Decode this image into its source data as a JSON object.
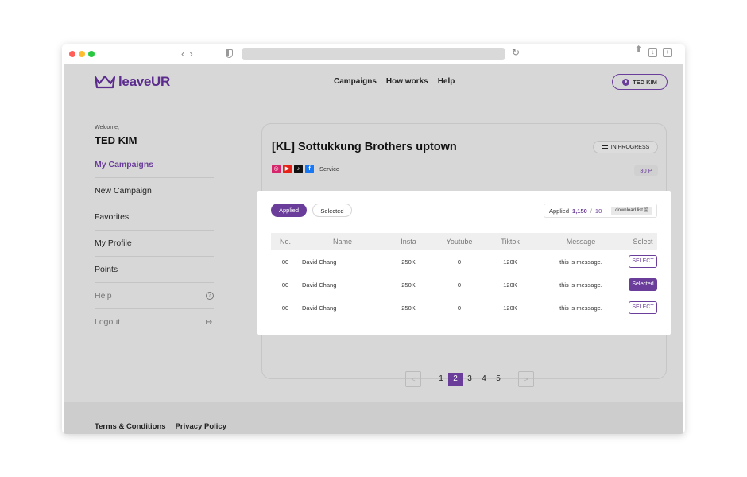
{
  "browser": {
    "icons": [
      "back-icon",
      "forward-icon",
      "shield-icon",
      "reload-icon",
      "share-icon",
      "download-icon",
      "new-tab-icon"
    ]
  },
  "header": {
    "logo_text": "leaveUR",
    "nav": [
      "Campaigns",
      "How works",
      "Help"
    ],
    "user_button": "TED KIM"
  },
  "sidebar": {
    "welcome": "Welcome,",
    "username": "TED KIM",
    "items": [
      {
        "label": "My Campaigns",
        "state": "active"
      },
      {
        "label": "New Campaign"
      },
      {
        "label": "Favorites"
      },
      {
        "label": "My Profile"
      },
      {
        "label": "Points"
      },
      {
        "label": "Help",
        "icon": "help-circle-icon"
      },
      {
        "label": "Logout",
        "icon": "logout-icon"
      }
    ]
  },
  "campaign": {
    "title": "[KL] Sottukkung Brothers uptown",
    "status": "IN PROGRESS",
    "platforms": [
      "instagram-icon",
      "youtube-icon",
      "tiktok-icon",
      "facebook-icon"
    ],
    "category": "Service",
    "points": "30 P"
  },
  "panel": {
    "tabs": [
      "Applied",
      "Selected"
    ],
    "active_tab": "Applied",
    "counter": {
      "label": "Applied",
      "applied": "1,150",
      "separator": "/",
      "total": "10",
      "download": "download list"
    },
    "columns": [
      "No.",
      "Name",
      "Insta",
      "Youtube",
      "Tiktok",
      "Message",
      "Select"
    ],
    "rows": [
      {
        "no": "00",
        "name": "David Chang",
        "insta": "250K",
        "youtube": "0",
        "tiktok": "120K",
        "message": "this is message.",
        "select": "SELECT"
      },
      {
        "no": "00",
        "name": "David Chang",
        "insta": "250K",
        "youtube": "0",
        "tiktok": "120K",
        "message": "this is message.",
        "select": "Selected"
      },
      {
        "no": "00",
        "name": "David Chang",
        "insta": "250K",
        "youtube": "0",
        "tiktok": "120K",
        "message": "this is message.",
        "select": "SELECT"
      }
    ]
  },
  "pagination": {
    "prev": "<",
    "next": ">",
    "pages": [
      "1",
      "2",
      "3",
      "4",
      "5"
    ],
    "current": "2"
  },
  "footer": {
    "links": [
      "Terms & Conditions",
      "Privacy Policy"
    ]
  },
  "colors": {
    "accent": "#6a3d9a",
    "page_bg": "#d7d7d7",
    "panel_bg": "#ffffff"
  }
}
